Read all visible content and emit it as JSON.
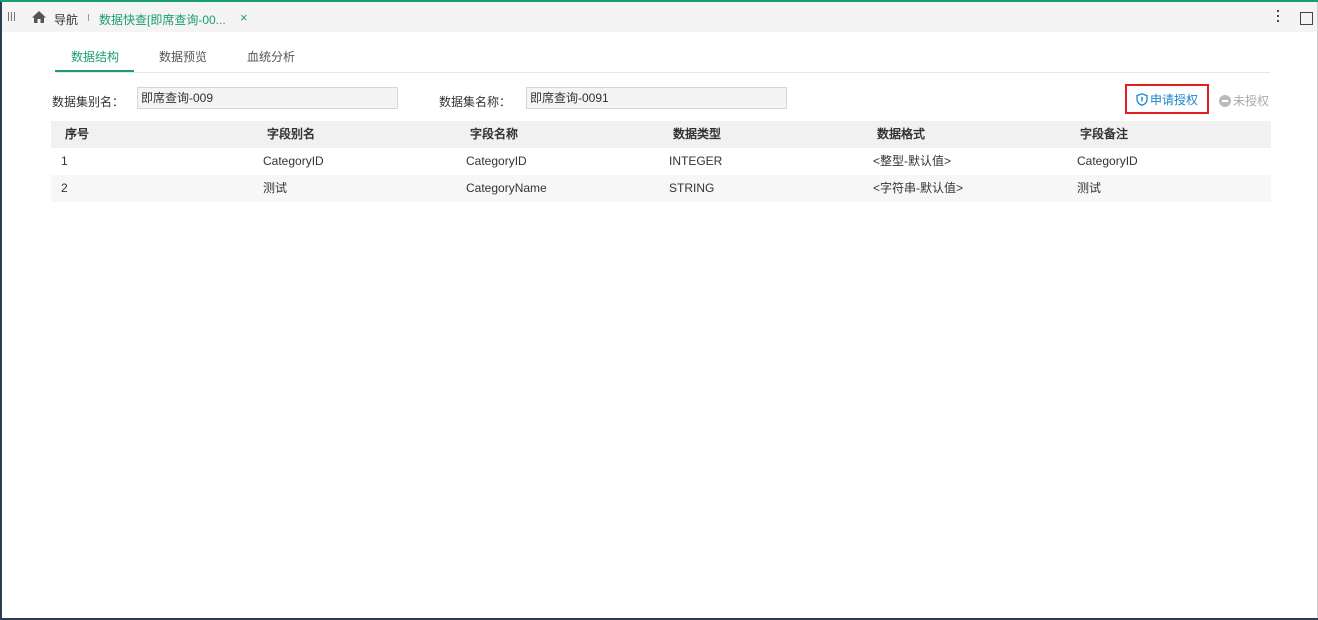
{
  "nav": {
    "home_label": "导航",
    "active_tab": "数据快查[即席查询-00...",
    "close_symbol": "×"
  },
  "subtabs": [
    "数据结构",
    "数据预览",
    "血统分析"
  ],
  "form": {
    "alias_label": "数据集别名：",
    "alias_value": "即席查询-009",
    "name_label": "数据集名称：",
    "name_value": "即席查询-0091"
  },
  "actions": {
    "apply_label": "申请授权",
    "unauth_label": "未授权"
  },
  "table": {
    "headers": [
      "序号",
      "字段别名",
      "字段名称",
      "数据类型",
      "数据格式",
      "字段备注"
    ],
    "rows": [
      [
        "1",
        "CategoryID",
        "CategoryID",
        "INTEGER",
        "<整型-默认值>",
        "CategoryID"
      ],
      [
        "2",
        "测试",
        "CategoryName",
        "STRING",
        "<字符串-默认值>",
        "测试"
      ]
    ]
  },
  "colors": {
    "accent": "#1a9d6f",
    "link": "#1a86c8",
    "highlight_border": "#e02020"
  },
  "icons": [
    "grip-icon",
    "home-icon",
    "close-icon",
    "more-vertical-icon",
    "maximize-icon",
    "shield-icon",
    "minus-circle-icon"
  ]
}
